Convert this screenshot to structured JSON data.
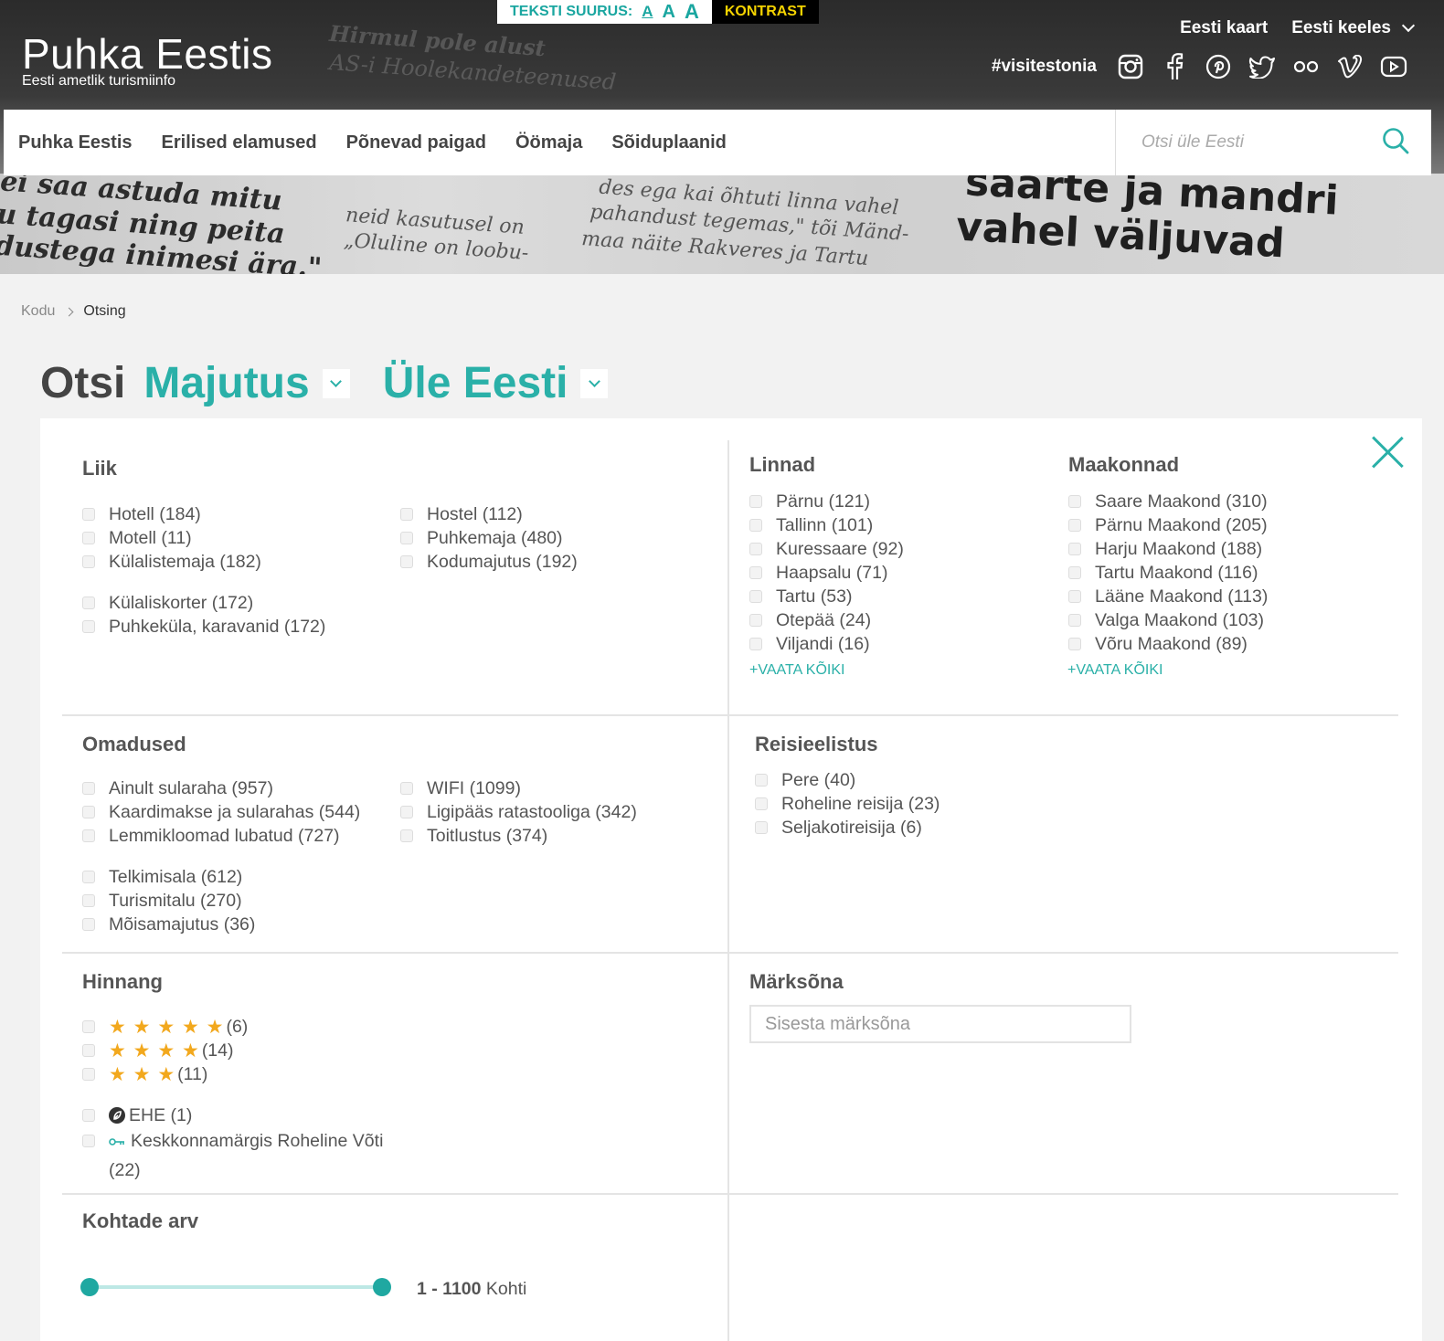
{
  "header": {
    "logo_title": "Puhka Eestis",
    "logo_subtitle": "Eesti ametlik turismiinfo",
    "text_size_label": "TEKSTI SUURUS:",
    "text_size_options": [
      "A",
      "A",
      "A"
    ],
    "contrast_label": "KONTRAST",
    "map_link": "Eesti kaart",
    "language": "Eesti keeles",
    "hashtag": "#visitestonia",
    "social_icons": [
      "instagram-icon",
      "facebook-icon",
      "pinterest-icon",
      "twitter-icon",
      "flickr-icon",
      "vimeo-icon",
      "youtube-icon"
    ]
  },
  "hero_text": {
    "line1": "Hirmul pole alust",
    "line2": "AS-i Hoolekandeteenused",
    "line3": "saarte ja mandri",
    "line4": "vahel väljuvad",
    "line5": "ei saa astuda mitu",
    "line6": "u tagasi ning peita",
    "line7": "dustega inimesi ära.\"",
    "line8": "des ega kai õhtuti linna vahel",
    "line9": "pahandust tegemas,\" tõi Mänd-",
    "line10": "maa näite Rakveres ja Tartu",
    "line11": "neid kasutusel on",
    "line12": "„Oluline on loobu-"
  },
  "nav": {
    "items": [
      "Puhka Eestis",
      "Erilised elamused",
      "Põnevad paigad",
      "Öömaja",
      "Sõiduplaanid"
    ],
    "search_placeholder": "Otsi üle Eesti"
  },
  "breadcrumb": {
    "home": "Kodu",
    "current": "Otsing"
  },
  "search_heading": {
    "prefix": "Otsi",
    "category": "Majutus",
    "region": "Üle Eesti"
  },
  "filters": {
    "liik": {
      "title": "Liik",
      "col1": [
        "Hotell (184)",
        "Motell (11)",
        "Külalistemaja (182)"
      ],
      "col1b": [
        "Külaliskorter (172)",
        "Puhkeküla, karavanid (172)"
      ],
      "col2": [
        "Hostel (112)",
        "Puhkemaja (480)",
        "Kodumajutus (192)"
      ]
    },
    "linnad": {
      "title": "Linnad",
      "items": [
        "Pärnu (121)",
        "Tallinn (101)",
        "Kuressaare (92)",
        "Haapsalu (71)",
        "Tartu (53)",
        "Otepää (24)",
        "Viljandi (16)"
      ],
      "more": "+VAATA KÕIKI"
    },
    "maakonnad": {
      "title": "Maakonnad",
      "items": [
        "Saare Maakond (310)",
        "Pärnu Maakond (205)",
        "Harju Maakond (188)",
        "Tartu Maakond (116)",
        "Lääne Maakond (113)",
        "Valga Maakond (103)",
        "Võru Maakond (89)"
      ],
      "more": "+VAATA KÕIKI"
    },
    "omadused": {
      "title": "Omadused",
      "col1": [
        "Ainult sularaha (957)",
        "Kaardimakse ja sularahas (544)",
        "Lemmikloomad lubatud (727)"
      ],
      "col1b": [
        "Telkimisala (612)",
        "Turismitalu (270)",
        "Mõisamajutus (36)"
      ],
      "col2": [
        "WIFI (1099)",
        "Ligipääs ratastooliga (342)",
        "Toitlustus (374)"
      ]
    },
    "reisieelistus": {
      "title": "Reisieelistus",
      "items": [
        "Pere (40)",
        "Roheline reisija (23)",
        "Seljakotireisija (6)"
      ]
    },
    "hinnang": {
      "title": "Hinnang",
      "stars": [
        {
          "stars": "★ ★ ★ ★ ★",
          "count": "(6)"
        },
        {
          "stars": "★ ★ ★ ★",
          "count": "(14)"
        },
        {
          "stars": "★ ★ ★",
          "count": "(11)"
        }
      ],
      "ehe": "EHE (1)",
      "green_key": "Keskkonnamärgis Roheline Võti",
      "green_key_count": "(22)"
    },
    "marksona": {
      "title": "Märksõna",
      "placeholder": "Sisesta märksõna"
    },
    "kohtade_arv": {
      "title": "Kohtade arv",
      "range": "1 - 1100",
      "unit": "Kohti",
      "min": 1,
      "max": 1100,
      "selected_min": 1,
      "selected_max": 1100
    }
  },
  "colors": {
    "accent": "#2ab0a8",
    "star": "#f2a81d",
    "contrast_text": "#f5d300"
  }
}
